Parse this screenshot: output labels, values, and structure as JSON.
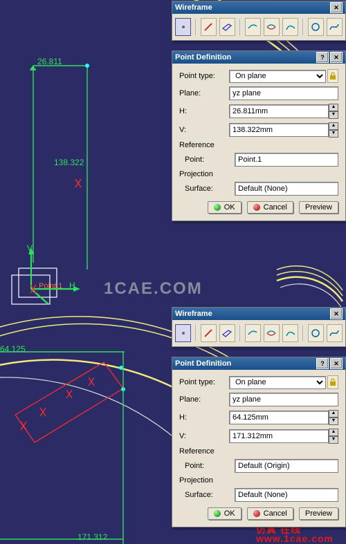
{
  "toolbars": {
    "top": {
      "title": "Wireframe"
    },
    "middle": {
      "title": "Wireframe"
    }
  },
  "dialog1": {
    "title": "Point Definition",
    "pointtype_label": "Point type:",
    "pointtype_value": "On plane",
    "plane_label": "Plane:",
    "plane_value": "yz plane",
    "h_label": "H:",
    "h_value": "26.811mm",
    "v_label": "V:",
    "v_value": "138.322mm",
    "reference_label": "Reference",
    "point_label": "Point:",
    "point_value": "Point.1",
    "projection_label": "Projection",
    "surface_label": "Surface:",
    "surface_value": "Default (None)",
    "ok": "OK",
    "cancel": "Cancel",
    "preview": "Preview"
  },
  "dialog2": {
    "title": "Point Definition",
    "pointtype_label": "Point type:",
    "pointtype_value": "On plane",
    "plane_label": "Plane:",
    "plane_value": "yz plane",
    "h_label": "H:",
    "h_value": "64.125mm",
    "v_label": "V:",
    "v_value": "171.312mm",
    "reference_label": "Reference",
    "point_label": "Point:",
    "point_value": "Default (Origin)",
    "projection_label": "Projection",
    "surface_label": "Surface:",
    "surface_value": "Default (None)",
    "ok": "OK",
    "cancel": "Cancel",
    "preview": "Preview"
  },
  "viewport": {
    "h_top": "26.811",
    "v_top": "138.322",
    "h_bottom": "64.125",
    "v_bottom": "171.312",
    "axis_v": "V",
    "axis_h": "H",
    "red_label": "Point.1"
  },
  "watermark_big": "1CAE.COM",
  "watermark_url": "www.1cae.com",
  "watermark_cn": "仿真  在线"
}
